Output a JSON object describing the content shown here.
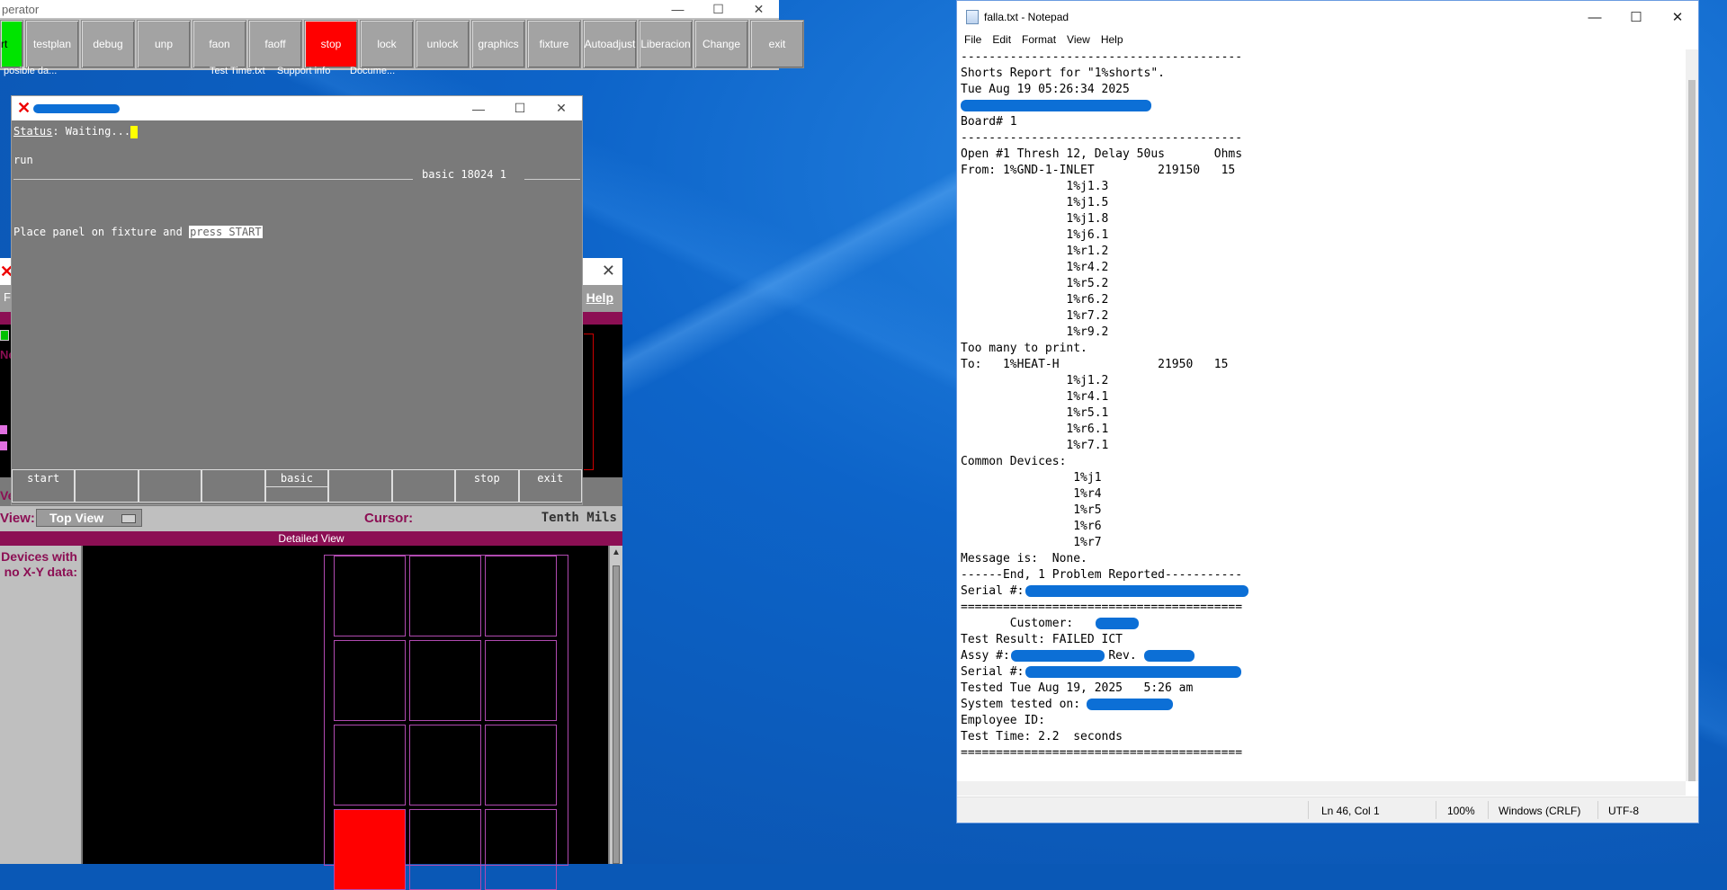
{
  "operator": {
    "title": "perator",
    "buttons": [
      "rt",
      "testplan",
      "debug",
      "unp",
      "faon",
      "faoff",
      "stop",
      "lock",
      "unlock",
      "graphics",
      "fixture",
      "Autoadjust",
      "Liberacion",
      "Change",
      "exit"
    ],
    "shortcuts": [
      "posible da...",
      "Test Time.txt",
      "Support info",
      "Docume..."
    ]
  },
  "status_window": {
    "status_label": "Status",
    "status_value": ": Waiting...",
    "run": "run",
    "mode_info": "basic 18024 1",
    "prompt": "Place panel on fixture and ",
    "prompt_highlight": "press START",
    "softkeys": [
      "start",
      "",
      "",
      "",
      "basic",
      "",
      "",
      "stop",
      "exit"
    ]
  },
  "ict_window": {
    "help": "Help",
    "view_label": "View:",
    "view_select": "Top View",
    "cursor_label": "Cursor:",
    "units": "Tenth Mils",
    "detail_title": "Detailed View",
    "left_panel": "Devices with no X-Y data:",
    "frag_f": "F",
    "frag_n": "Ne",
    "frag_ve": "Ve"
  },
  "notepad": {
    "title": "falla.txt - Notepad",
    "menu": [
      "File",
      "Edit",
      "Format",
      "View",
      "Help"
    ],
    "lines": [
      "----------------------------------------",
      "Shorts Report for \"1%shorts\".",
      "Tue Aug 19 05:26:34 2025",
      "",
      "Board# 1",
      "----------------------------------------",
      "Open #1 Thresh 12, Delay 50us       Ohms",
      "From: 1%GND-1-INLET         219150   15",
      "               1%j1.3",
      "               1%j1.5",
      "               1%j1.8",
      "               1%j6.1",
      "               1%r1.2",
      "               1%r4.2",
      "               1%r5.2",
      "               1%r6.2",
      "               1%r7.2",
      "               1%r9.2",
      "Too many to print.",
      "To:   1%HEAT-H              21950   15",
      "               1%j1.2",
      "               1%r4.1",
      "               1%r5.1",
      "               1%r6.1",
      "               1%r7.1",
      "Common Devices:",
      "                1%j1",
      "                1%r4",
      "                1%r5",
      "                1%r6",
      "                1%r7",
      "Message is:  None.",
      "------End, 1 Problem Reported-----------",
      "Serial #: ",
      "========================================",
      "       Customer:  ",
      "Test Result: FAILED ICT",
      "Assy #:              Rev. ",
      "Serial #: ",
      "Tested Tue Aug 19, 2025   5:26 am",
      "System tested on: ",
      "Employee ID:",
      "Test Time: 2.2  seconds",
      "========================================",
      ""
    ],
    "status": {
      "position": "Ln 46, Col 1",
      "zoom": "100%",
      "line_endings": "Windows (CRLF)",
      "encoding": "UTF-8"
    }
  },
  "colors": {
    "accent_redaction": "#0c6fd6",
    "ict_maroon": "#8c0f54",
    "stop_red": "#ff0000",
    "start_green": "#00e400"
  }
}
